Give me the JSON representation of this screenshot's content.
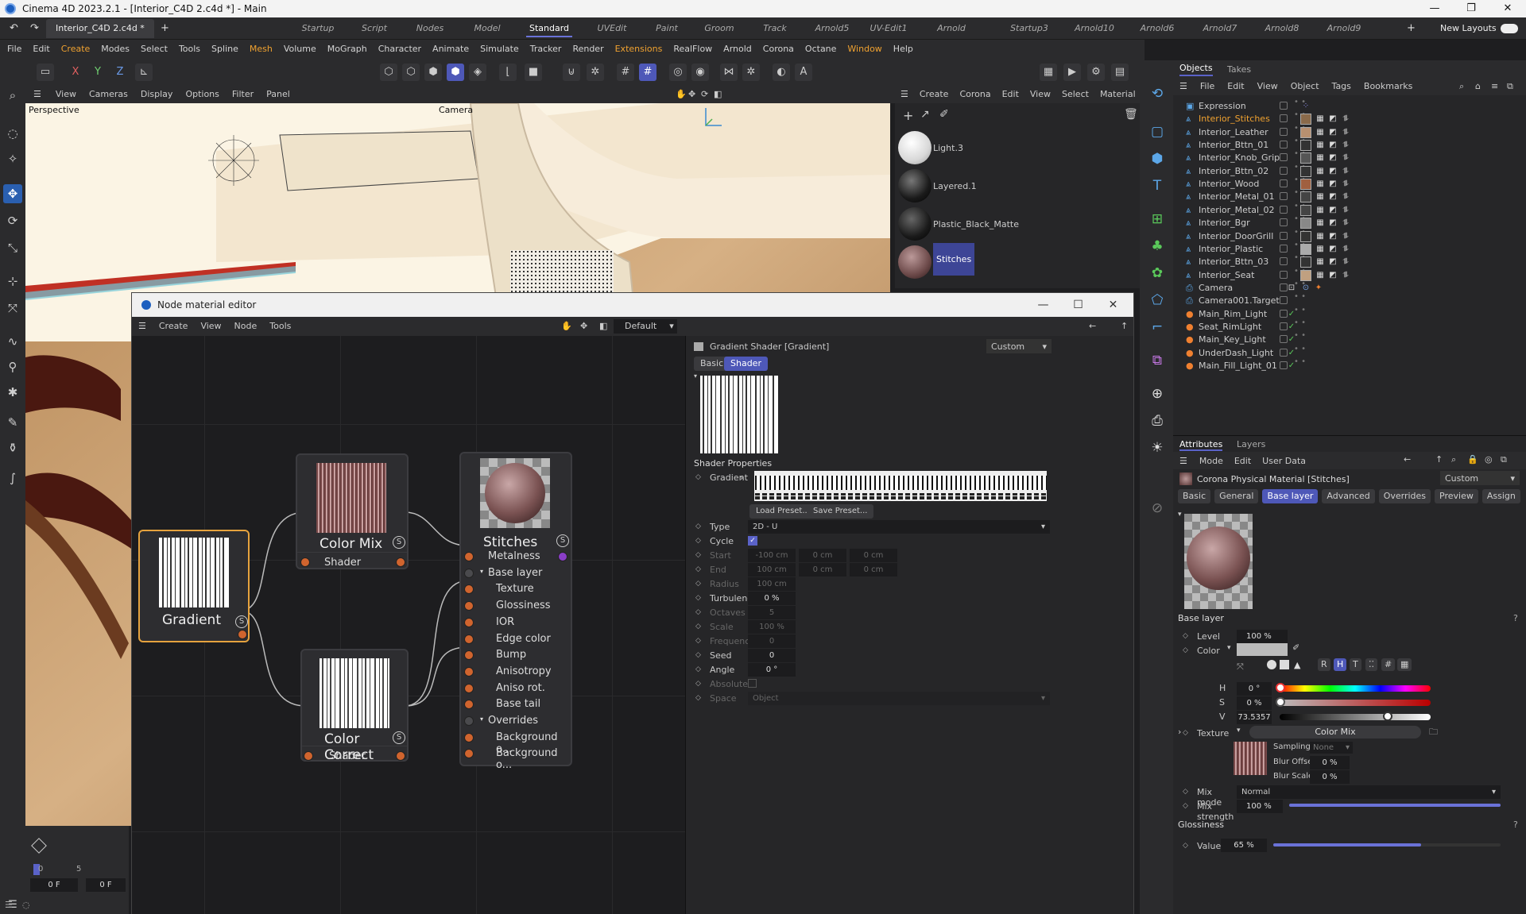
{
  "window": {
    "title": "Cinema 4D 2023.2.1 - [Interior_C4D 2.c4d *] - Main"
  },
  "tabs": {
    "doc": "Interior_C4D 2.c4d *",
    "layouts": [
      "Startup",
      "Script",
      "Nodes",
      "Model",
      "Standard",
      "UVEdit",
      "Paint",
      "Groom",
      "Track",
      "Arnold5",
      "UV-Edit1",
      "Arnold Render",
      "Startup3",
      "Arnold10",
      "Arnold6",
      "Arnold7",
      "Arnold8",
      "Arnold9"
    ],
    "active_layout": "Standard",
    "new_layouts": "New Layouts"
  },
  "menu": [
    "File",
    "Edit",
    "Create",
    "Modes",
    "Select",
    "Tools",
    "Spline",
    "Mesh",
    "Volume",
    "MoGraph",
    "Character",
    "Animate",
    "Simulate",
    "Tracker",
    "Render",
    "Extensions",
    "RealFlow",
    "Arnold",
    "Corona",
    "Octane",
    "Window",
    "Help"
  ],
  "axis": {
    "x": "X",
    "y": "Y",
    "z": "Z"
  },
  "viewport": {
    "menu": [
      "View",
      "Cameras",
      "Display",
      "Options",
      "Filter",
      "Panel"
    ],
    "label": "Perspective",
    "camera": "Camera"
  },
  "timeline": {
    "start": "0",
    "tick": "5",
    "frame_a": "0 F",
    "frame_b": "0 F"
  },
  "material_manager": {
    "menu": [
      "Create",
      "Corona",
      "Edit",
      "View",
      "Select",
      "Material"
    ],
    "materials": [
      {
        "name": "Light.3"
      },
      {
        "name": "Layered.1"
      },
      {
        "name": "Plastic_Black_Matte"
      },
      {
        "name": "Stitches"
      }
    ]
  },
  "node_editor": {
    "title": "Node material editor",
    "menu": [
      "Create",
      "View",
      "Node",
      "Tools"
    ],
    "preset": "Default",
    "nodes": {
      "gradient": {
        "title": "Gradient"
      },
      "color_mix": {
        "title": "Color Mix",
        "port": "Shader"
      },
      "color_correct": {
        "title": "Color Correct",
        "port": "Shader"
      },
      "stitches": {
        "title": "Stitches",
        "ports": [
          "Metalness",
          "Base layer",
          "Texture",
          "Glossiness",
          "IOR",
          "Edge color",
          "Bump",
          "Anisotropy",
          "Aniso rot.",
          "Base tail",
          "Overrides",
          "Background o...",
          "Background o..."
        ]
      }
    },
    "attrs": {
      "header": "Gradient Shader [Gradient]",
      "mode": "Custom",
      "tab_basic": "Basic",
      "tab_shader": "Shader",
      "section": "Shader Properties",
      "gradient_label": "Gradient",
      "load_preset": "Load Preset...",
      "save_preset": "Save Preset...",
      "type_label": "Type",
      "type_value": "2D - U",
      "cycle_label": "Cycle",
      "start_label": "Start",
      "start": [
        "-100 cm",
        "0 cm",
        "0 cm"
      ],
      "end_label": "End",
      "end": [
        "100 cm",
        "0 cm",
        "0 cm"
      ],
      "radius_label": "Radius",
      "radius": "100 cm",
      "turbulence_label": "Turbulence",
      "turbulence": "0 %",
      "octaves_label": "Octaves",
      "octaves": "5",
      "scale_label": "Scale",
      "scale": "100 %",
      "frequency_label": "Frequency",
      "frequency": "0",
      "seed_label": "Seed",
      "seed": "0",
      "angle_label": "Angle",
      "angle": "0 °",
      "absolute_label": "Absolute",
      "space_label": "Space",
      "space": "Object"
    }
  },
  "objects": {
    "tabs": [
      "Objects",
      "Takes"
    ],
    "menu": [
      "File",
      "Edit",
      "View",
      "Object",
      "Tags",
      "Bookmarks"
    ],
    "items": [
      "Expression",
      "Interior_Stitches",
      "Interior_Leather",
      "Interior_Bttn_01",
      "Interior_Knob_Grip",
      "Interior_Bttn_02",
      "Interior_Wood",
      "Interior_Metal_01",
      "Interior_Metal_02",
      "Interior_Bgr",
      "Interior_DoorGrill",
      "Interior_Plastic",
      "Interior_Bttn_03",
      "Interior_Seat",
      "Camera",
      "Camera001.Target",
      "Main_Rim_Light",
      "Seat_RimLight",
      "Main_Key_Light",
      "UnderDash_Light",
      "Main_Fill_Light_01"
    ],
    "selected": "Interior_Stitches"
  },
  "attributes": {
    "tabs": [
      "Attributes",
      "Layers"
    ],
    "menu": [
      "Mode",
      "Edit",
      "User Data"
    ],
    "material": "Corona Physical Material [Stitches]",
    "mode": "Custom",
    "subtabs": [
      "Basic",
      "General",
      "Base layer",
      "Advanced",
      "Overrides",
      "Preview",
      "Assign"
    ],
    "active_subtab": "Base layer",
    "section": "Base layer",
    "level_label": "Level",
    "level": "100 %",
    "color_label": "Color",
    "color_modes": [
      "R",
      "H",
      "T",
      "#"
    ],
    "h_label": "H",
    "h": "0 °",
    "s_label": "S",
    "s": "0 %",
    "v_label": "V",
    "v": "73.5357 %",
    "texture_label": "Texture",
    "texture": "Color Mix",
    "sampling_label": "Sampling",
    "sampling": "None",
    "blur_offset_label": "Blur Offset",
    "blur_offset": "0 %",
    "blur_scale_label": "Blur Scale",
    "blur_scale": "0 %",
    "mix_mode_label": "Mix mode",
    "mix_mode": "Normal",
    "mix_strength_label": "Mix strength",
    "mix_strength": "100 %",
    "glossiness_label": "Glossiness",
    "value_label": "Value",
    "value": "65 %"
  },
  "colors": {
    "accent": "#4e58b8",
    "highlight": "#f0a230",
    "port": "#d0642e"
  }
}
